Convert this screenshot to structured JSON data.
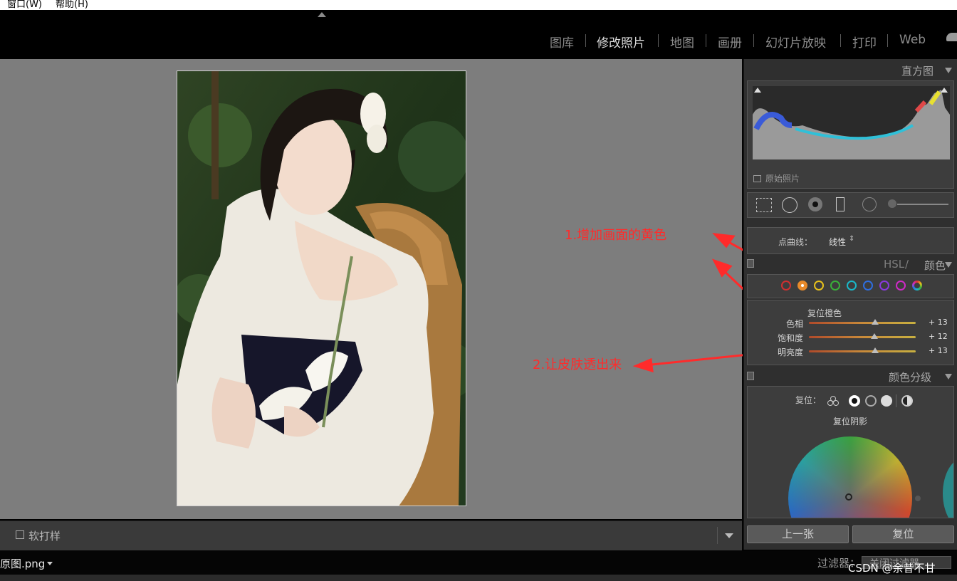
{
  "menu": {
    "window": "窗口(W)",
    "help": "帮助(H)"
  },
  "modules": [
    "图库",
    "修改照片",
    "地图",
    "画册",
    "幻灯片放映",
    "打印",
    "Web"
  ],
  "active_module": "修改照片",
  "histogram": {
    "title": "直方图",
    "original_photo": "原始照片"
  },
  "curve": {
    "label": "点曲线：",
    "value": "线性"
  },
  "hsl": {
    "title_a": "HSL",
    "slash": " / ",
    "title_b": "颜色",
    "reset": "复位橙色",
    "swatches": [
      "#d03030",
      "#e88a2a",
      "#e8c21c",
      "#3ab03a",
      "#1ab8c8",
      "#2e6ee0",
      "#8a3ae0",
      "#d02ac8"
    ],
    "selected": "#e88a2a",
    "sliders": [
      {
        "label": "色相",
        "value": "+ 13",
        "pct": 0.62
      },
      {
        "label": "饱和度",
        "value": "+ 12",
        "pct": 0.61
      },
      {
        "label": "明亮度",
        "value": "+ 13",
        "pct": 0.62
      }
    ]
  },
  "color_grading": {
    "title": "颜色分级",
    "reset_label": "复位：",
    "reset_shadows": "复位阴影"
  },
  "buttons": {
    "prev": "上一张",
    "reset": "复位"
  },
  "toolbar": {
    "soft_proof": "软打样"
  },
  "filmstrip": {
    "filename": "原图.png",
    "filter": "过滤器：",
    "filter_value": "关闭过滤器"
  },
  "watermark": "CSDN @余昔不甘",
  "annotations": {
    "one": "1.增加画面的黄色",
    "two": "2.让皮肤透出来"
  },
  "colors": {
    "annotation": "#ff2b2b",
    "canvas": "#7d7d7d",
    "panel": "#2f2f2f"
  }
}
